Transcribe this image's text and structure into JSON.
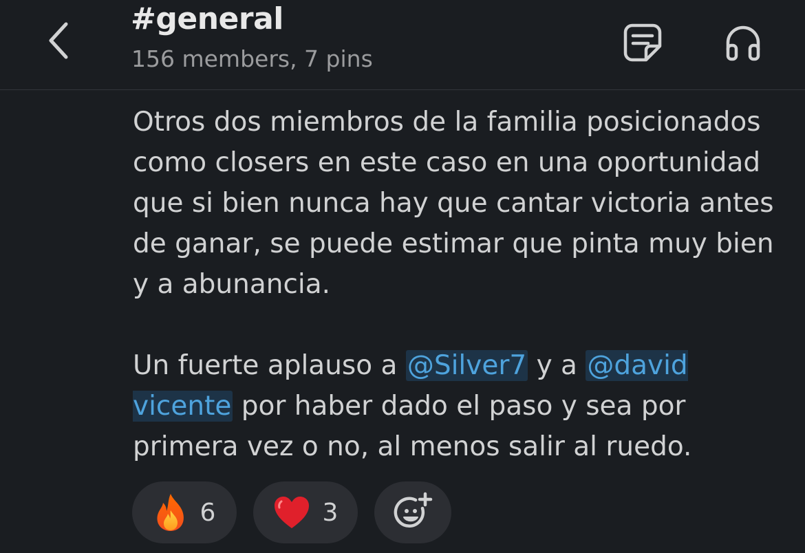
{
  "header": {
    "channel_name": "#general",
    "channel_meta": "156 members, 7 pins"
  },
  "icons": {
    "back": "chevron-left-icon",
    "canvas": "canvas-icon",
    "huddle": "headphones-icon"
  },
  "message": {
    "paragraph1": "Otros dos miembros de la familia posicionados como closers en este caso en una oportunidad que si bien nunca hay que cantar victoria antes de ganar, se puede estimar que pinta muy bien y a abunancia.",
    "p2_text1": "Un fuerte aplauso a ",
    "mention1": "@Silver7",
    "p2_text2": " y a ",
    "mention2": "@david vicente",
    "p2_text3": " por haber dado el paso y sea por primera vez o no, al menos salir al ruedo."
  },
  "reactions": [
    {
      "emoji": "fire",
      "count": "6"
    },
    {
      "emoji": "red-heart",
      "count": "3"
    }
  ],
  "colors": {
    "background": "#1a1d21",
    "mention": "#4ea3dd",
    "mention_bg": "#1d3347",
    "pill": "#2c2e33"
  }
}
